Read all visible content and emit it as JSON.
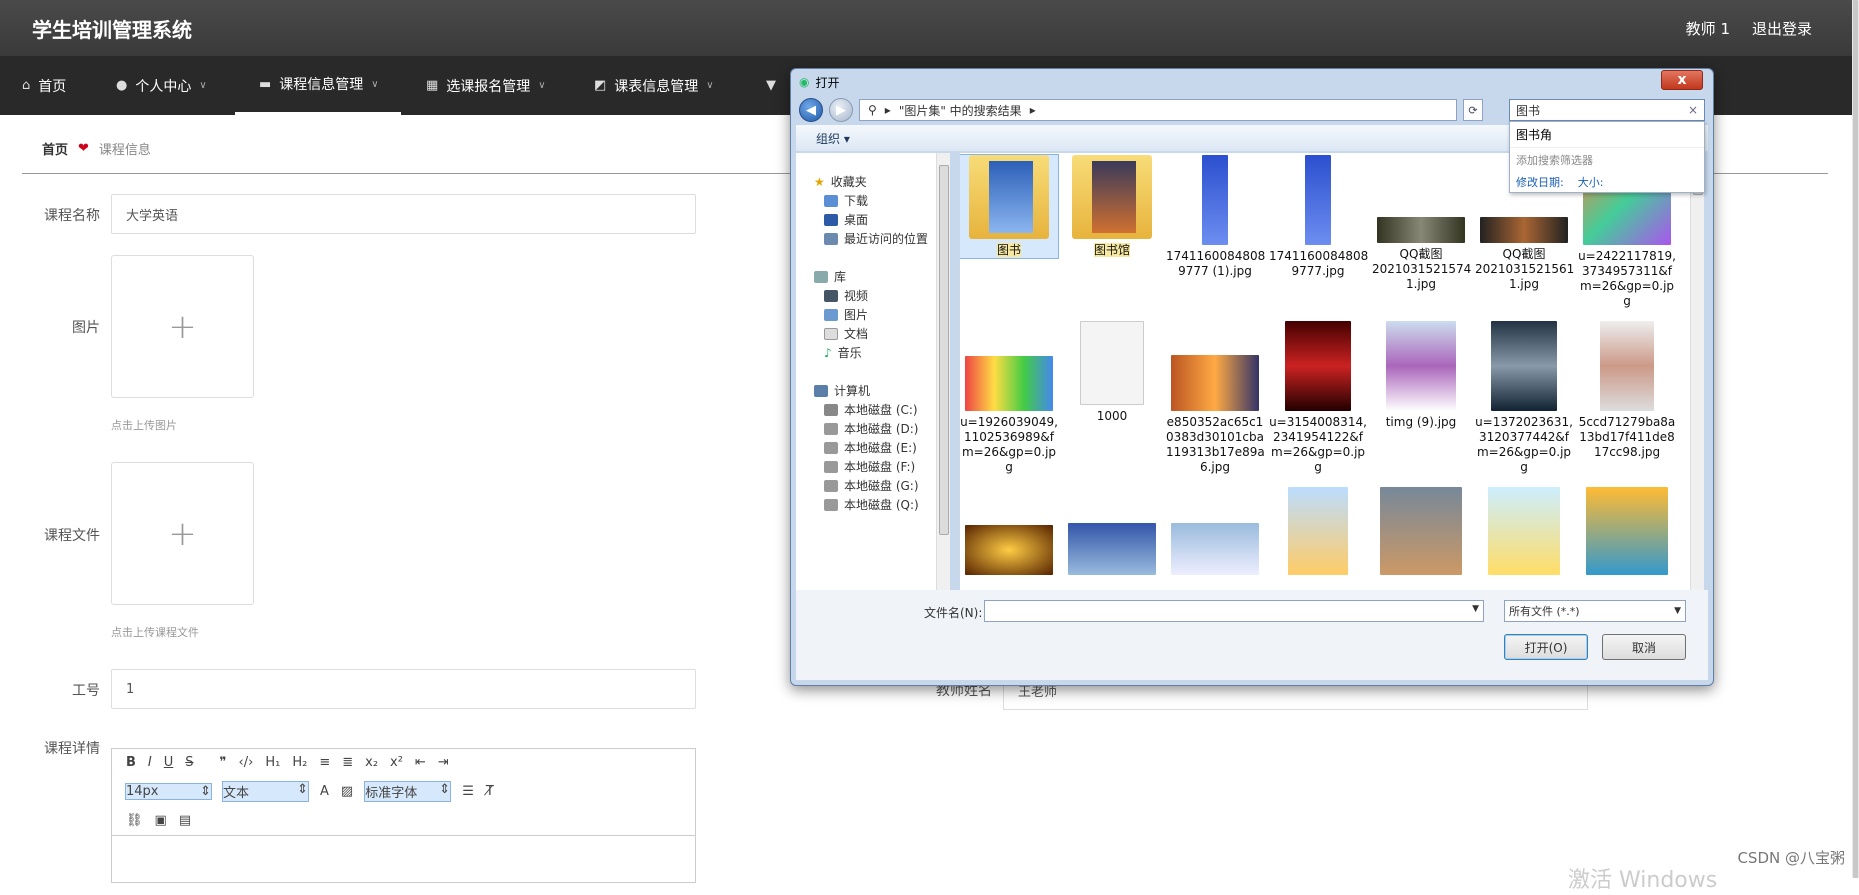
{
  "app": {
    "title": "学生培训管理系统",
    "user": "教师 1",
    "logout": "退出登录"
  },
  "nav": [
    {
      "label": "首页",
      "icon": "home-icon"
    },
    {
      "label": "个人中心",
      "icon": "user-icon"
    },
    {
      "label": "课程信息管理",
      "icon": "briefcase-icon"
    },
    {
      "label": "选课报名管理",
      "icon": "grid-icon"
    },
    {
      "label": "课表信息管理",
      "icon": "chart-icon"
    }
  ],
  "breadcrumb": {
    "home": "首页",
    "current": "课程信息"
  },
  "form": {
    "course_name_label": "课程名称",
    "course_name_value": "大学英语",
    "image_label": "图片",
    "image_hint": "点击上传图片",
    "file_label": "课程文件",
    "file_hint": "点击上传课程文件",
    "job_no_label": "工号",
    "job_no_value": "1",
    "teacher_label": "教师姓名",
    "teacher_value": "王老师",
    "detail_label": "课程详情",
    "upload_plus": "+",
    "editor": {
      "font_size": "14px",
      "format": "文本",
      "font": "标准字体"
    }
  },
  "watermark": "CSDN @八宝粥",
  "win_activate": "激活 Windows",
  "dialog": {
    "title": "打开",
    "path": "\"图片集\" 中的搜索结果",
    "search_value": "图书",
    "suggestion": "图书角",
    "add_filter": "添加搜索筛选器",
    "filter_date": "修改日期:",
    "filter_size": "大小:",
    "organize": "组织 ▾",
    "nav": {
      "favorites": "收藏夹",
      "downloads": "下载",
      "desktop": "桌面",
      "recent": "最近访问的位置",
      "libraries": "库",
      "videos": "视频",
      "pictures": "图片",
      "documents": "文档",
      "music": "音乐",
      "computer": "计算机",
      "drives": [
        "本地磁盘 (C:)",
        "本地磁盘 (D:)",
        "本地磁盘 (E:)",
        "本地磁盘 (F:)",
        "本地磁盘 (G:)",
        "本地磁盘 (Q:)"
      ]
    },
    "files": [
      {
        "name": "图书",
        "kind": "folder"
      },
      {
        "name": "图书馆",
        "kind": "folder"
      },
      {
        "name": "1741160084808\n9777 (1).jpg",
        "kind": "image"
      },
      {
        "name": "1741160084808\n9777.jpg",
        "kind": "image"
      },
      {
        "name": "QQ截图\n2021031521574\n1.jpg",
        "kind": "image"
      },
      {
        "name": "QQ截图\n2021031521561\n1.jpg",
        "kind": "image"
      },
      {
        "name": "u=2422117819,\n3734957311&f\nm=26&gp=0.jp\ng",
        "kind": "image"
      },
      {
        "name": "u=1926039049,\n1102536989&f\nm=26&gp=0.jp\ng",
        "kind": "image"
      },
      {
        "name": "1000",
        "kind": "blank"
      },
      {
        "name": "e850352ac65c1\n0383d30101cba\n119313b17e89a\n6.jpg",
        "kind": "image"
      },
      {
        "name": "u=3154008314,\n2341954122&f\nm=26&gp=0.jp\ng",
        "kind": "image"
      },
      {
        "name": "timg (9).jpg",
        "kind": "image"
      },
      {
        "name": "u=1372023631,\n3120377442&f\nm=26&gp=0.jp\ng",
        "kind": "image"
      },
      {
        "name": "5ccd71279ba8a\n13bd17f411de8\n17cc98.jpg",
        "kind": "image"
      }
    ],
    "filename_label": "文件名(N):",
    "filetype": "所有文件 (*.*)",
    "open": "打开(O)",
    "cancel": "取消",
    "close": "x"
  }
}
